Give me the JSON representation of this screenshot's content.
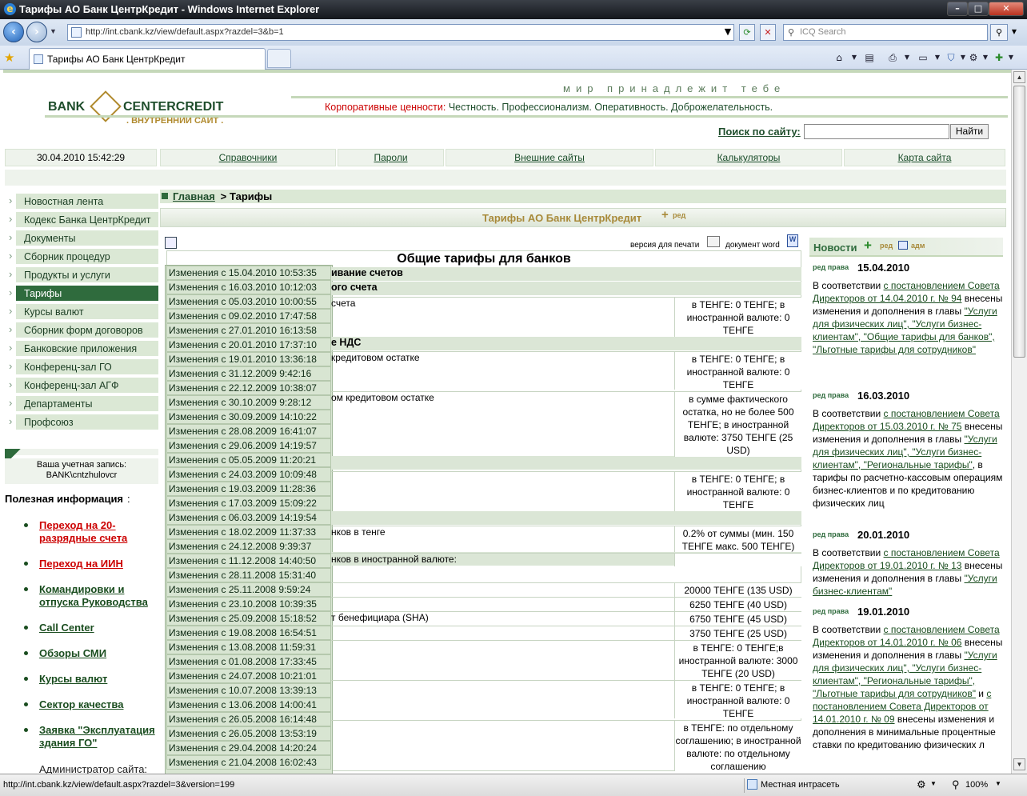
{
  "browser": {
    "window_title": "Тарифы АО Банк ЦентрКредит - Windows Internet Explorer",
    "address": "http://int.cbank.kz/view/default.aspx?razdel=3&b=1",
    "search_placeholder": "ICQ Search",
    "tab_title": "Тарифы АО Банк ЦентрКредит",
    "status_url": "http://int.cbank.kz/view/default.aspx?razdel=3&version=199",
    "zone": "Местная интрасеть",
    "zoom": "100%"
  },
  "site": {
    "slogan": "мир принадлежит тебе",
    "logo_left": "BANK",
    "logo_right": "CENTERCREDIT",
    "logo_sub": ". ВНУТРЕННИЙ САЙТ .",
    "values_label": "Корпоративные ценности:",
    "values_text": "Честность.  Профессионализм.  Оперативность.  Доброжелательность.",
    "search_label": "Поиск по сайту:",
    "search_button": "Найти",
    "datetime": "30.04.2010 15:42:29",
    "nav": [
      "Справочники",
      "Пароли",
      "Внешние сайты",
      "Калькуляторы",
      "Карта сайта"
    ]
  },
  "breadcrumb": {
    "home": "Главная",
    "sep": " > ",
    "current": "Тарифы"
  },
  "page_header": {
    "title": "Тарифы АО Банк ЦентрКредит",
    "edit": "ред"
  },
  "left_menu": [
    "Новостная лента",
    "Кодекс Банка ЦентрКредит",
    "Документы",
    "Сборник процедур",
    "Продукты и услуги",
    "Тарифы",
    "Курсы валют",
    "Сборник форм договоров",
    "Банковские приложения",
    "Конференц-зал ГО",
    "Конференц-зал АГФ",
    "Департаменты",
    "Профсоюз"
  ],
  "account": {
    "label": "Ваша учетная запись:",
    "user": "BANK\\cntzhulovcr"
  },
  "useful": {
    "title": "Полезная информация",
    "items": [
      "Переход на 20-разрядные счета",
      "Переход на ИИН",
      "Командировки и отпуска Руководства",
      "Call Center",
      "Обзоры СМИ",
      "Курсы валют",
      "Сектор качества",
      "Заявка \"Эксплуатация здания ГО\""
    ],
    "admin": "Администратор сайта:"
  },
  "doc": {
    "print_version": "версия для печати",
    "word_doc": "документ word",
    "title": "Общие тарифы для банков",
    "sections": [
      "ивание счетов",
      "ого счета",
      "е НДС"
    ],
    "rows": [
      {
        "left": "счета",
        "right": "в ТЕНГЕ: 0 ТЕНГЕ; в иностранной валюте: 0 ТЕНГЕ"
      },
      {
        "left": "кредитовом остатке",
        "right": "в ТЕНГЕ: 0 ТЕНГЕ; в иностранной валюте: 0 ТЕНГЕ"
      },
      {
        "left": "ом кредитовом остатке",
        "right": "в сумме фактического остатка, но не более 500 ТЕНГЕ; в иностранной валюте: 3750 ТЕНГЕ (25 USD)"
      },
      {
        "left": "",
        "right": "в ТЕНГЕ: 0 ТЕНГЕ; в иностранной валюте: 0 ТЕНГЕ"
      },
      {
        "left": "нков в тенге",
        "right": "0.2% от суммы (мин. 150 ТЕНГЕ макс. 500 ТЕНГЕ)"
      },
      {
        "left": "нков в иностранной валюте:",
        "right": ""
      },
      {
        "left": "",
        "right": "20000 ТЕНГЕ (135 USD)"
      },
      {
        "left": "",
        "right": "6250 ТЕНГЕ (40 USD)"
      },
      {
        "left": "т бенефициара (SHA)",
        "right": "6750 ТЕНГЕ (45 USD)"
      },
      {
        "left": "",
        "right": "3750 ТЕНГЕ (25 USD)"
      },
      {
        "left": "",
        "right": "в ТЕНГЕ: 0 ТЕНГЕ;в иностранной валюте: 3000 ТЕНГЕ (20 USD)"
      },
      {
        "left": "",
        "right": "в ТЕНГЕ: 0 ТЕНГЕ; в иностранной валюте: 0 ТЕНГЕ"
      },
      {
        "left": "",
        "right": "в ТЕНГЕ: по отдельному соглашению; в иностранной валюте: по отдельному соглашению"
      }
    ],
    "history": [
      "Изменения с 15.04.2010 10:53:35",
      "Изменения с 16.03.2010 10:12:03",
      "Изменения с 05.03.2010 10:00:55",
      "Изменения с 09.02.2010 17:47:58",
      "Изменения с 27.01.2010 16:13:58",
      "Изменения с 20.01.2010 17:37:10",
      "Изменения с 19.01.2010 13:36:18",
      "Изменения с 31.12.2009 9:42:16",
      "Изменения с 22.12.2009 10:38:07",
      "Изменения с 30.10.2009 9:28:12",
      "Изменения с 30.09.2009 14:10:22",
      "Изменения с 28.08.2009 16:41:07",
      "Изменения с 29.06.2009 14:19:57",
      "Изменения с 05.05.2009 11:20:21",
      "Изменения с 24.03.2009 10:09:48",
      "Изменения с 19.03.2009 11:28:36",
      "Изменения с 17.03.2009 15:09:22",
      "Изменения с 06.03.2009 14:19:54",
      "Изменения с 18.02.2009 11:37:33",
      "Изменения с 24.12.2008 9:39:37",
      "Изменения с 11.12.2008 14:40:50",
      "Изменения с 28.11.2008 15:31:40",
      "Изменения с 25.11.2008 9:59:24",
      "Изменения с 23.10.2008 10:39:35",
      "Изменения с 25.09.2008 15:18:52",
      "Изменения с 19.08.2008 16:54:51",
      "Изменения с 13.08.2008 11:59:31",
      "Изменения с 01.08.2008 17:33:45",
      "Изменения с 24.07.2008 10:21:01",
      "Изменения с 10.07.2008 13:39:13",
      "Изменения с 13.06.2008 14:00:41",
      "Изменения с 26.05.2008 16:14:48",
      "Изменения с 26.05.2008 13:53:19",
      "Изменения с 29.04.2008 14:20:24",
      "Изменения с 21.04.2008 16:02:43"
    ]
  },
  "news": {
    "title": "Новости",
    "edit": "ред",
    "adm": "адм",
    "meta": "ред права",
    "items": [
      {
        "date": "15.04.2010",
        "pre": "В соответствии ",
        "link": "с постановлением Совета Директоров от 14.04.2010 г. № 94",
        "post": " внесены изменения и дополнения в главы ",
        "chapters": "\"Услуги для физических лиц\", \"Услуги бизнес-клиентам\", \"Общие тарифы для банков\", \"Льготные тарифы для сотрудников\""
      },
      {
        "date": "16.03.2010",
        "pre": "В соответствии ",
        "link": "с постановлением Совета Директоров от 15.03.2010 г. № 75",
        "post": " внесены изменения и дополнения в главы ",
        "chapters": "\"Услуги для физических лиц\", \"Услуги бизнес-клиентам\", \"Региональные тарифы\"",
        "tail": ", в тарифы по расчетно-кассовым операциям бизнес-клиентов и по кредитованию физических лиц"
      },
      {
        "date": "20.01.2010",
        "pre": "В соответствии ",
        "link": "с постановлением Совета Директоров от 19.01.2010 г. № 13",
        "post": " внесены изменения и дополнения в главы ",
        "chapters": "\"Услуги бизнес-клиентам\""
      },
      {
        "date": "19.01.2010",
        "pre": "В соответствии ",
        "link": "с постановлением Совета Директоров от 14.01.2010 г. № 06",
        "post": " внесены изменения и дополнения в главы ",
        "chapters": "\"Услуги для физических лиц\", \"Услуги бизнес-клиентам\", \"Региональные тарифы\", \"Льготные тарифы для сотрудников\"",
        "tail2": " и ",
        "link2": "с постановлением Совета Директоров от 14.01.2010 г. № 09",
        "tail3": " внесены изменения и дополнения в минимальные процентные ставки по кредитованию физических л"
      }
    ]
  },
  "colors": {
    "brand_green": "#2f6b3d",
    "light_green": "#dbe8d5",
    "gold": "#b08a2e",
    "red": "#cc0000"
  }
}
